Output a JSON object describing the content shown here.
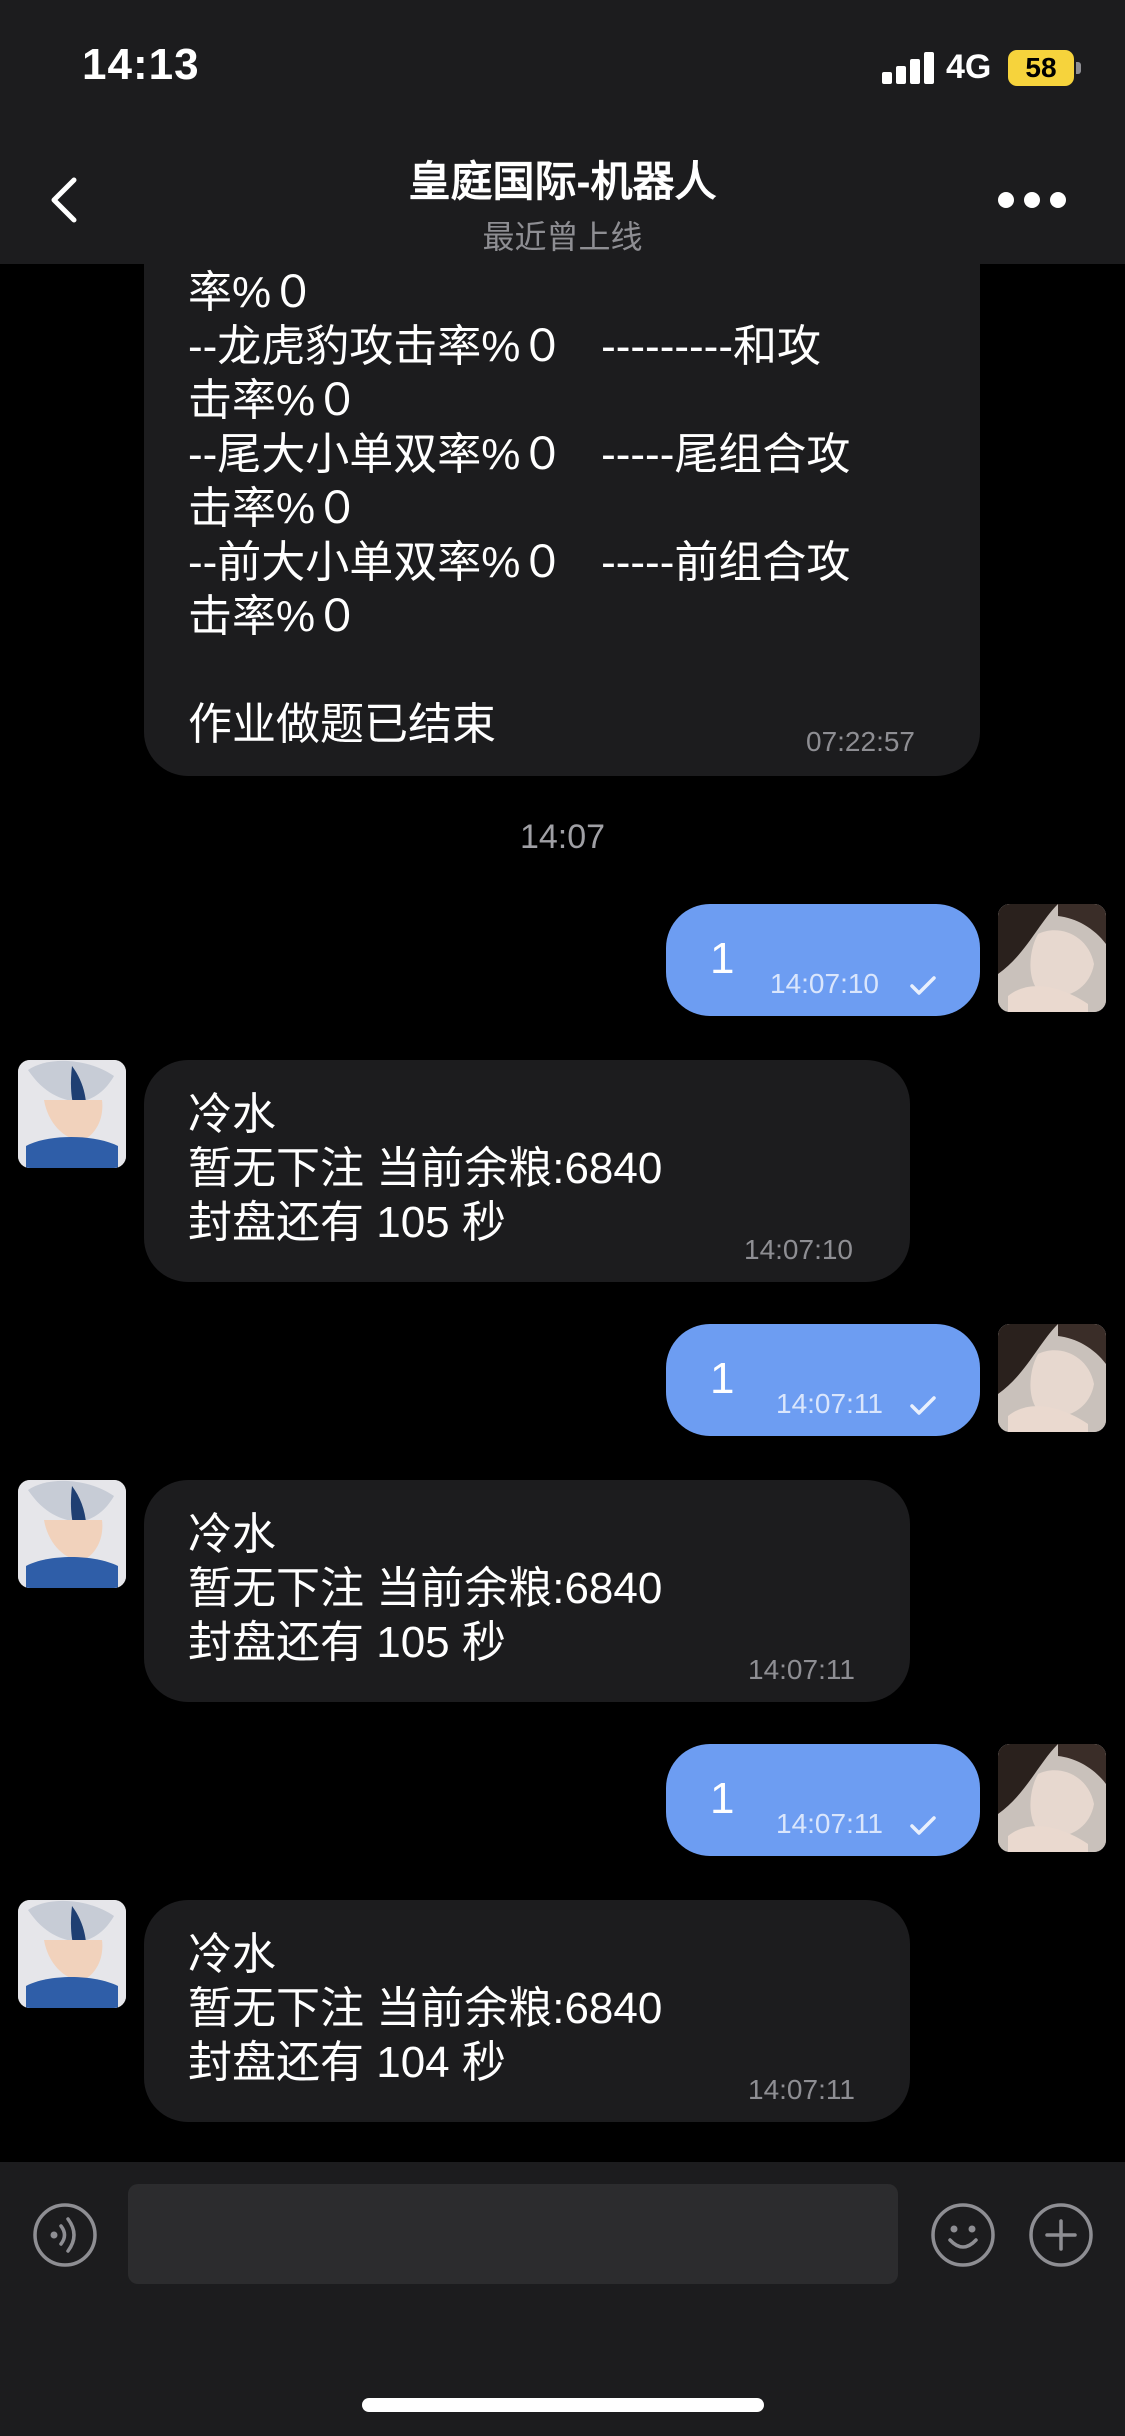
{
  "status_bar": {
    "time": "14:13",
    "network": "4G",
    "battery": "58"
  },
  "header": {
    "title": "皇庭国际-机器人",
    "subtitle": "最近曾上线"
  },
  "messages": {
    "m0": {
      "text": "率%０\n--龙虎豹攻击率%０   ---------和攻\n击率%０\n--尾大小单双率%０   -----尾组合攻\n击率%０\n--前大小单双率%０   -----前组合攻\n击率%０\n\n作业做题已结束",
      "time": "07:22:57"
    },
    "date_separator": "14:07",
    "m1": {
      "text": "1",
      "time": "14:07:10"
    },
    "m2": {
      "text": "冷水\n暂无下注 当前余粮:6840\n封盘还有 105 秒",
      "time": "14:07:10"
    },
    "m3": {
      "text": "1",
      "time": "14:07:11"
    },
    "m4": {
      "text": "冷水\n暂无下注 当前余粮:6840\n封盘还有 105 秒",
      "time": "14:07:11"
    },
    "m5": {
      "text": "1",
      "time": "14:07:11"
    },
    "m6": {
      "text": "冷水\n暂无下注 当前余粮:6840\n封盘还有 104 秒",
      "time": "14:07:11"
    }
  },
  "input": {
    "placeholder": ""
  },
  "icons": {
    "back": "chevron-left-icon",
    "more": "more-dots-icon",
    "voice": "voice-icon",
    "emoji": "emoji-icon",
    "plus": "plus-icon",
    "read": "check-icon"
  },
  "colors": {
    "outgoing_bubble": "#6d9df2",
    "incoming_bubble": "#1c1c1e",
    "bar_background": "#1c1c1e",
    "battery": "#f6d33c"
  }
}
